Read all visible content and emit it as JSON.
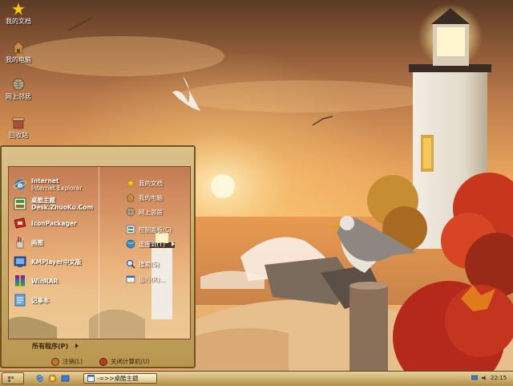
{
  "desktop": {
    "icons": [
      {
        "label": "我的文档",
        "icon": "star-icon"
      },
      {
        "label": "我的电脑",
        "icon": "house-icon"
      },
      {
        "label": "网上邻居",
        "icon": "globe-icon"
      },
      {
        "label": "回收站",
        "icon": "recycle-bin-icon"
      }
    ]
  },
  "start_menu": {
    "left_items": [
      {
        "title": "Internet",
        "subtitle": "Internet Explorer",
        "icon": "internet-explorer-icon"
      },
      {
        "title": "桌酷主题",
        "subtitle": "Desk.ZhuoKu.Com",
        "icon": "theme-icon"
      },
      {
        "title": "IconPackager",
        "subtitle": "",
        "icon": "iconpackager-icon"
      },
      {
        "title": "画图",
        "subtitle": "",
        "icon": "paint-icon"
      },
      {
        "title": "KMPlayer中文版",
        "subtitle": "",
        "icon": "kmplayer-icon"
      },
      {
        "title": "WinRAR",
        "subtitle": "",
        "icon": "winrar-icon"
      },
      {
        "title": "记事本",
        "subtitle": "",
        "icon": "notepad-icon"
      }
    ],
    "right_items": [
      {
        "label": "我的文档",
        "icon": "star-icon"
      },
      {
        "label": "我的电脑",
        "icon": "house-icon"
      },
      {
        "label": "网上邻居",
        "icon": "globe-icon"
      },
      {
        "label": "控制面板(C)",
        "icon": "control-panel-icon"
      },
      {
        "label": "连接到(T)",
        "icon": "network-icon"
      },
      {
        "label": "搜索(S)",
        "icon": "search-icon"
      },
      {
        "label": "运行(R)...",
        "icon": "run-icon"
      }
    ],
    "all_programs": "所有程序(P)",
    "logoff": "注销(L)",
    "shutdown": "关闭计算机(U)"
  },
  "taskbar": {
    "window_title": "-=>>桌酷主题",
    "clock": "22:15"
  },
  "colors": {
    "taskbar": "#c9ad6a",
    "menu_frame": "#b8974f",
    "logoff_icon": "#c0781f",
    "shutdown_icon": "#b8401c"
  }
}
